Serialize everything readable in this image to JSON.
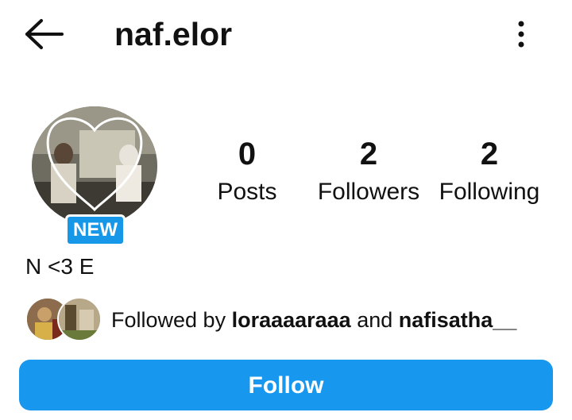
{
  "header": {
    "back_icon": "arrow-left-icon",
    "username": "naf.elor",
    "more_icon": "more-vertical-icon"
  },
  "profile": {
    "badge": "NEW",
    "bio": "N <3 E"
  },
  "stats": {
    "posts": {
      "count": "0",
      "label": "Posts"
    },
    "followers": {
      "count": "2",
      "label": "Followers"
    },
    "following": {
      "count": "2",
      "label": "Following"
    }
  },
  "mutual": {
    "prefix": "Followed by ",
    "user1": "loraaaaraaa",
    "joiner": " and ",
    "user2": "nafisatha__"
  },
  "actions": {
    "follow_label": "Follow"
  },
  "colors": {
    "accent": "#1797ee",
    "text": "#111111",
    "background": "#ffffff"
  }
}
